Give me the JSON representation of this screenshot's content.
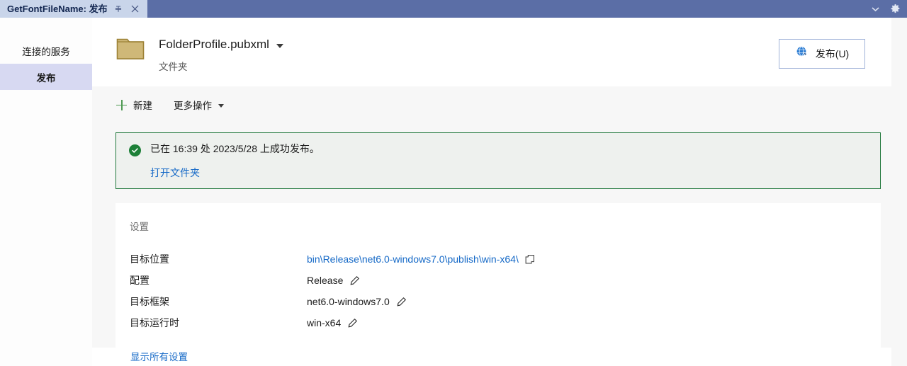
{
  "titlebar": {
    "tab_title": "GetFontFileName: 发布",
    "pin_icon": "pin-icon",
    "close_icon": "close-icon",
    "dropdown_icon": "chevron-down-icon",
    "settings_icon": "gear-icon",
    "background_color": "#5b6ea6",
    "tab_background_color": "#c9d5ea"
  },
  "sidebar": {
    "items": [
      {
        "label": "连接的服务",
        "selected": false
      },
      {
        "label": "发布",
        "selected": true
      }
    ],
    "selected_color": "#d7d9f2"
  },
  "profile": {
    "icon": "folder-icon",
    "name": "FolderProfile.pubxml",
    "dropdown_icon": "chevron-down-icon",
    "subtitle": "文件夹"
  },
  "publish_button": {
    "label": "发布(U)",
    "icon": "publish-globe-icon",
    "border_color": "#a0b2d8"
  },
  "toolbar": {
    "new_label": "新建",
    "new_icon": "plus-icon",
    "more_actions_label": "更多操作",
    "more_actions_icon": "chevron-down-icon",
    "plus_color": "#4f9a53"
  },
  "banner": {
    "icon": "success-check-icon",
    "message": "已在 16:39 处 2023/5/28 上成功发布。",
    "link_label": "打开文件夹",
    "border_color": "#21783c",
    "background_color": "#eef1ee",
    "accent_color": "#1d8038"
  },
  "settings": {
    "title": "设置",
    "rows": [
      {
        "key": "目标位置",
        "value": "bin\\Release\\net6.0-windows7.0\\publish\\win-x64\\",
        "is_link": true,
        "action_icon": "copy-icon"
      },
      {
        "key": "配置",
        "value": "Release",
        "is_link": false,
        "action_icon": "pencil-icon"
      },
      {
        "key": "目标框架",
        "value": "net6.0-windows7.0",
        "is_link": false,
        "action_icon": "pencil-icon"
      },
      {
        "key": "目标运行时",
        "value": "win-x64",
        "is_link": false,
        "action_icon": "pencil-icon"
      }
    ],
    "show_all_label": "显示所有设置",
    "link_color": "#1569c7"
  }
}
